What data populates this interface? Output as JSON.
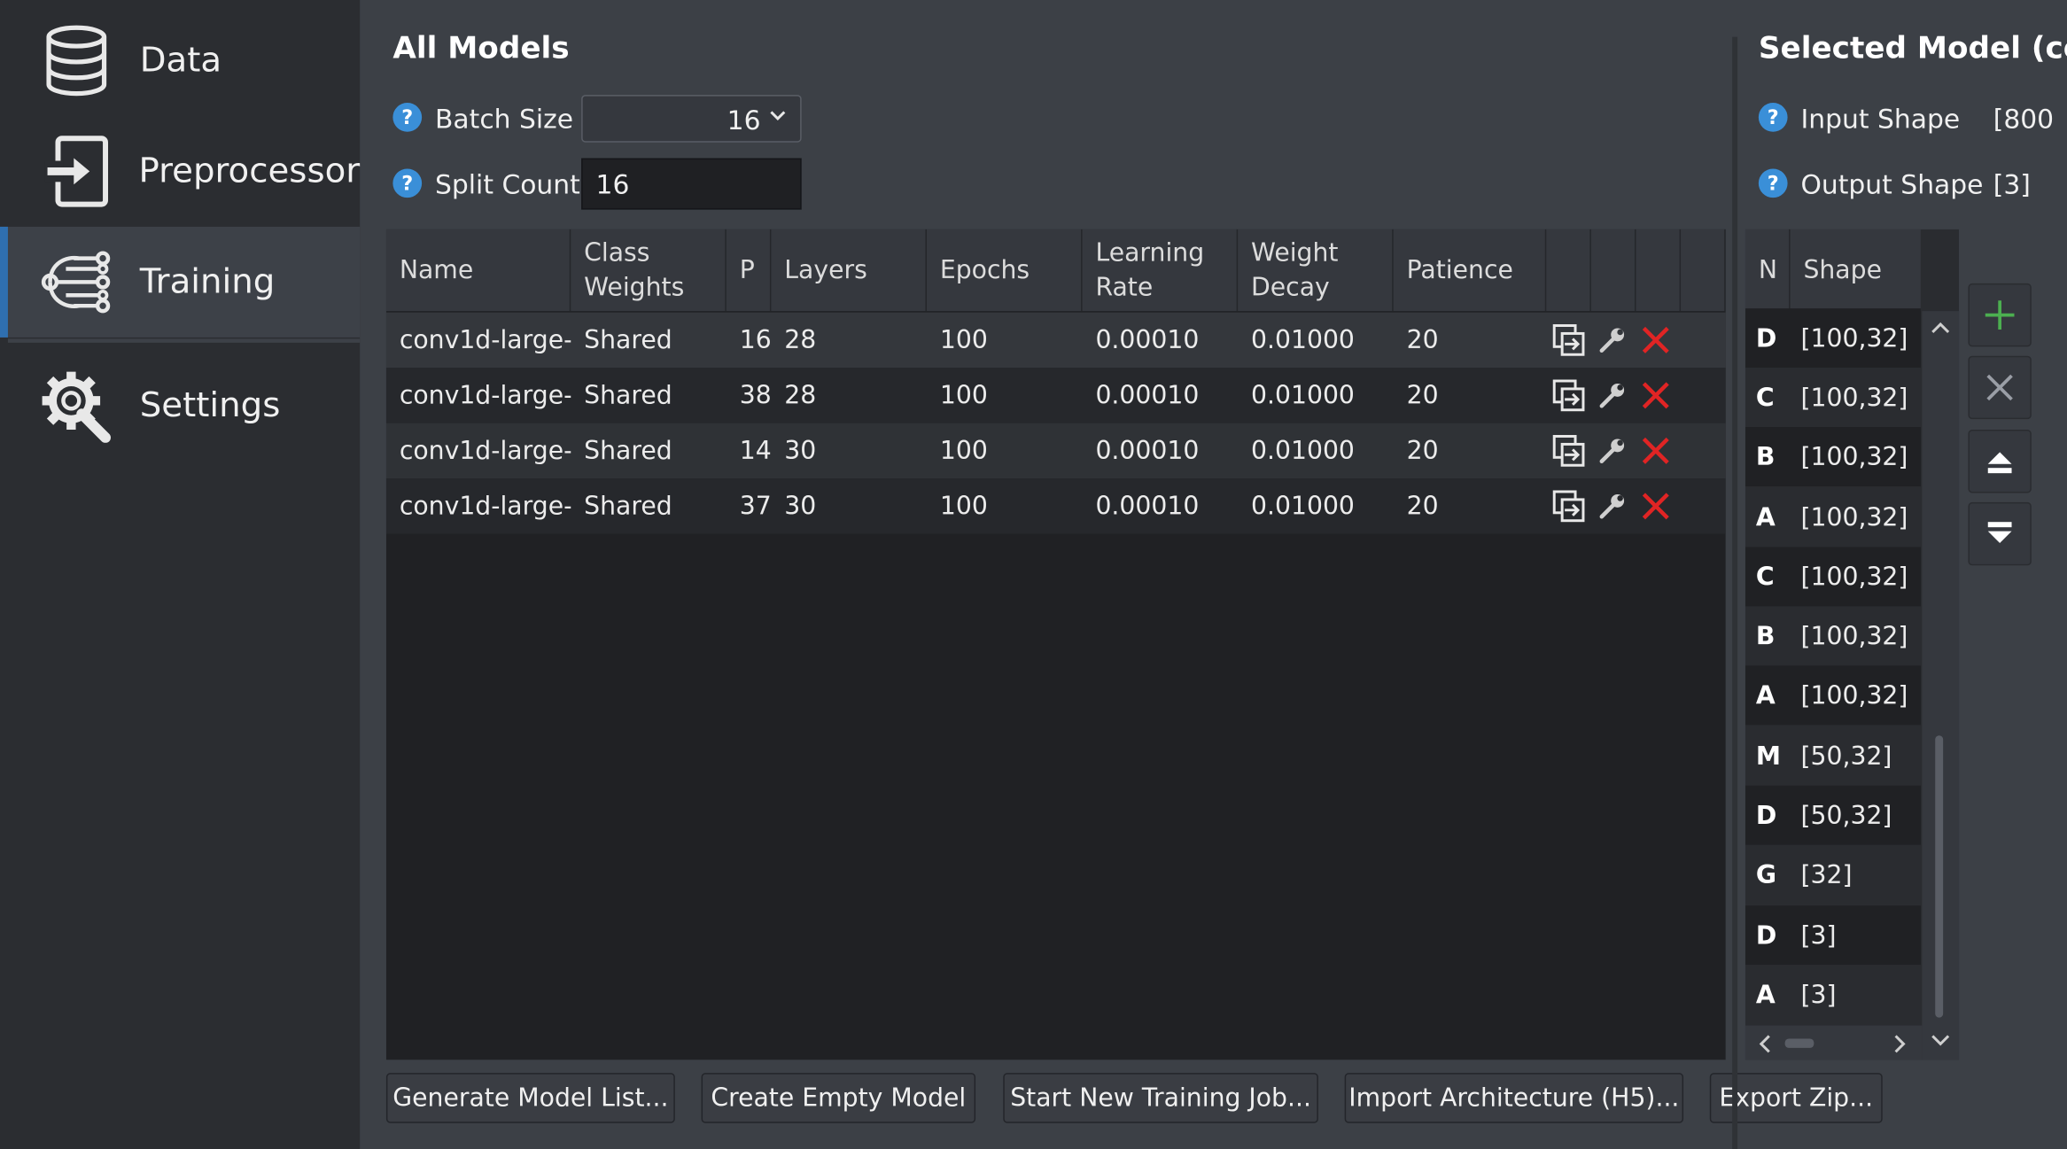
{
  "nav": {
    "items": [
      {
        "label": "Data",
        "icon": "database-icon"
      },
      {
        "label": "Preprocessor",
        "icon": "import-icon"
      },
      {
        "label": "Training",
        "icon": "network-icon"
      },
      {
        "label": "Settings",
        "icon": "gear-wrench-icon"
      }
    ],
    "active": "Training"
  },
  "all_models": {
    "title": "All Models",
    "batch_size_label": "Batch Size",
    "batch_size_value": "16",
    "split_count_label": "Split Count",
    "split_count_value": "16",
    "columns": [
      "Name",
      "Class\nWeights",
      "P",
      "Layers",
      "Epochs",
      "Learning\nRate",
      "Weight\nDecay",
      "Patience"
    ],
    "rows": [
      {
        "name": "conv1d-large-",
        "class_weights": "Shared",
        "p": "16",
        "layers": "28",
        "epochs": "100",
        "lr": "0.00010",
        "wd": "0.01000",
        "patience": "20"
      },
      {
        "name": "conv1d-large-",
        "class_weights": "Shared",
        "p": "38",
        "layers": "28",
        "epochs": "100",
        "lr": "0.00010",
        "wd": "0.01000",
        "patience": "20"
      },
      {
        "name": "conv1d-large-",
        "class_weights": "Shared",
        "p": "14",
        "layers": "30",
        "epochs": "100",
        "lr": "0.00010",
        "wd": "0.01000",
        "patience": "20"
      },
      {
        "name": "conv1d-large-",
        "class_weights": "Shared",
        "p": "37",
        "layers": "30",
        "epochs": "100",
        "lr": "0.00010",
        "wd": "0.01000",
        "patience": "20"
      }
    ]
  },
  "selected_model": {
    "title": "Selected Model (co",
    "input_shape_label": "Input Shape",
    "input_shape_value": "[800",
    "output_shape_label": "Output Shape",
    "output_shape_value": "[3]",
    "columns": [
      "N",
      "Shape"
    ],
    "layers": [
      {
        "n": "D",
        "shape": "[100,32]"
      },
      {
        "n": "C",
        "shape": "[100,32]"
      },
      {
        "n": "B",
        "shape": "[100,32]"
      },
      {
        "n": "A",
        "shape": "[100,32]"
      },
      {
        "n": "C",
        "shape": "[100,32]"
      },
      {
        "n": "B",
        "shape": "[100,32]"
      },
      {
        "n": "A",
        "shape": "[100,32]"
      },
      {
        "n": "M",
        "shape": "[50,32]"
      },
      {
        "n": "D",
        "shape": "[50,32]"
      },
      {
        "n": "G",
        "shape": "[32]"
      },
      {
        "n": "D",
        "shape": "[3]"
      },
      {
        "n": "A",
        "shape": "[3]"
      }
    ]
  },
  "buttons": {
    "generate": "Generate Model List...",
    "create_empty": "Create Empty Model",
    "start_training": "Start New Training Job...",
    "import_arch": "Import Architecture (H5)...",
    "export_zip": "Export Zip..."
  },
  "colors": {
    "accent": "#2f6fb0",
    "help": "#3a8fd8",
    "delete": "#e02424",
    "add": "#4caf50"
  }
}
